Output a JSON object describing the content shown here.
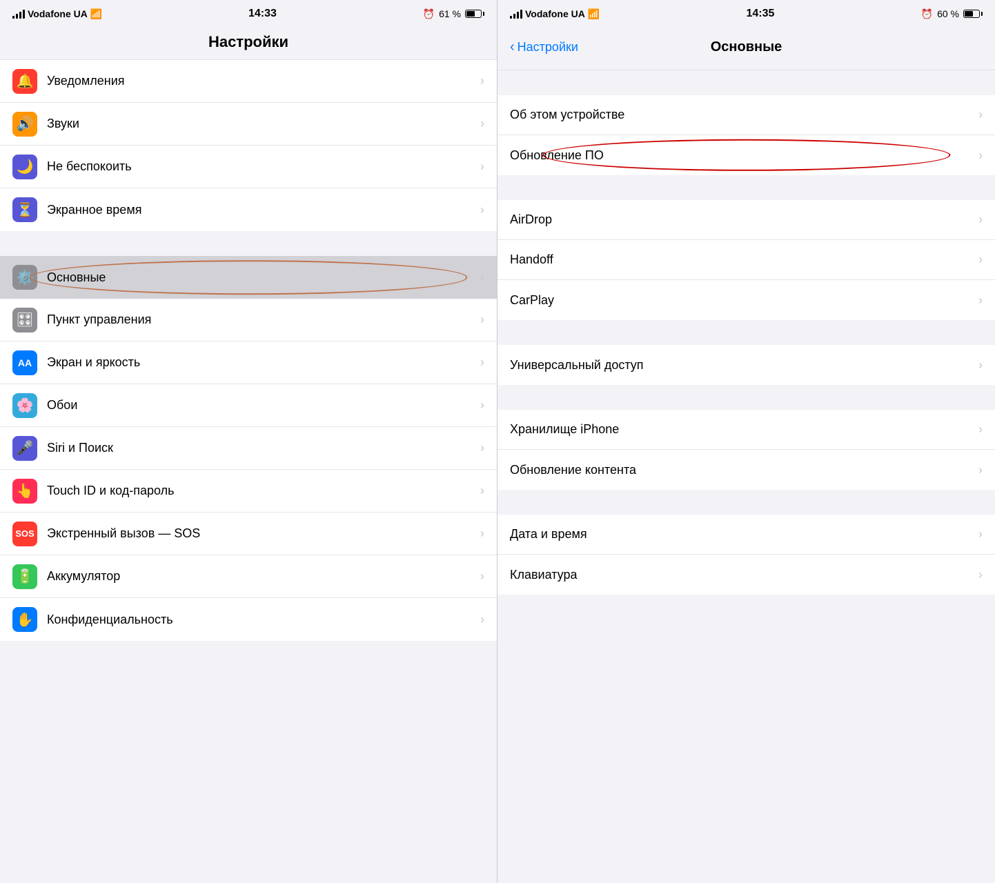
{
  "left_panel": {
    "status_bar": {
      "carrier": "Vodafone UA",
      "time": "14:33",
      "alarm": "⏰",
      "battery_percent": "61 %",
      "battery_fill_width": "61%"
    },
    "title": "Настройки",
    "groups": [
      {
        "items": [
          {
            "id": "notifications",
            "label": "Уведомления",
            "icon_bg": "#ff3b30",
            "icon": "🔔"
          },
          {
            "id": "sounds",
            "label": "Звуки",
            "icon_bg": "#ff9500",
            "icon": "🔊"
          },
          {
            "id": "donotdisturb",
            "label": "Не беспокоить",
            "icon_bg": "#5856d6",
            "icon": "🌙"
          },
          {
            "id": "screentime",
            "label": "Экранное время",
            "icon_bg": "#5856d6",
            "icon": "⏳"
          }
        ]
      },
      {
        "items": [
          {
            "id": "general",
            "label": "Основные",
            "icon_bg": "#8e8e93",
            "icon": "⚙️",
            "highlighted": true
          }
        ]
      },
      {
        "items": [
          {
            "id": "controlcenter",
            "label": "Пункт управления",
            "icon_bg": "#8e8e93",
            "icon": "🎛"
          },
          {
            "id": "display",
            "label": "Экран и яркость",
            "icon_bg": "#007aff",
            "icon": "AA"
          },
          {
            "id": "wallpaper",
            "label": "Обои",
            "icon_bg": "#34aadc",
            "icon": "🌸"
          },
          {
            "id": "siri",
            "label": "Siri и Поиск",
            "icon_bg": "#5856d6",
            "icon": "🎤"
          },
          {
            "id": "touchid",
            "label": "Touch ID и код-пароль",
            "icon_bg": "#ff2d55",
            "icon": "👆"
          },
          {
            "id": "sos",
            "label": "Экстренный вызов — SOS",
            "icon_bg": "#ff3b30",
            "icon": "SOS"
          },
          {
            "id": "battery",
            "label": "Аккумулятор",
            "icon_bg": "#34c759",
            "icon": "🔋"
          },
          {
            "id": "privacy",
            "label": "Конфиденциальность",
            "icon_bg": "#007aff",
            "icon": "✋"
          }
        ]
      }
    ]
  },
  "right_panel": {
    "status_bar": {
      "carrier": "Vodafone UA",
      "time": "14:35",
      "alarm": "⏰",
      "battery_percent": "60 %",
      "battery_fill_width": "60%"
    },
    "back_label": "Настройки",
    "title": "Основные",
    "groups": [
      {
        "items": [
          {
            "id": "about",
            "label": "Об этом устройстве"
          },
          {
            "id": "softwareupdate",
            "label": "Обновление ПО",
            "annotate": true
          }
        ]
      },
      {
        "items": [
          {
            "id": "airdrop",
            "label": "AirDrop"
          },
          {
            "id": "handoff",
            "label": "Handoff"
          },
          {
            "id": "carplay",
            "label": "CarPlay"
          }
        ]
      },
      {
        "items": [
          {
            "id": "accessibility",
            "label": "Универсальный доступ"
          }
        ]
      },
      {
        "items": [
          {
            "id": "iphone-storage",
            "label": "Хранилище iPhone"
          },
          {
            "id": "bgapprefresh",
            "label": "Обновление контента"
          }
        ]
      },
      {
        "items": [
          {
            "id": "datetime",
            "label": "Дата и время"
          },
          {
            "id": "keyboard",
            "label": "Клавиатура"
          }
        ]
      }
    ]
  },
  "icons": {
    "signal": "▌▌▌▌",
    "wifi": "wifi",
    "chevron_right": "›",
    "back_chevron": "‹"
  }
}
